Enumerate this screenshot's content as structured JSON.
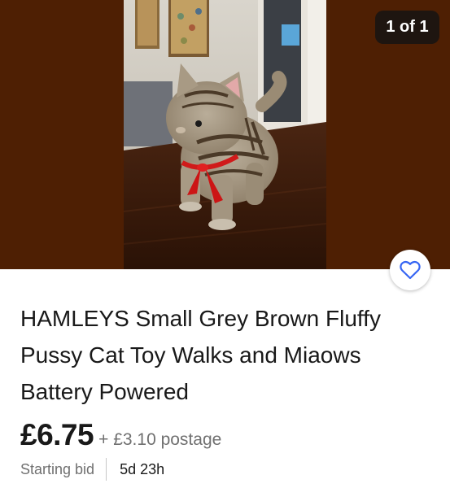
{
  "gallery": {
    "counter": "1 of 1",
    "background_color": "#4e1f03",
    "photo_subject": "grey-brown striped toy cat with red ribbon on wooden table"
  },
  "watch_button": {
    "icon": "heart-outline-icon",
    "color": "#3665f3"
  },
  "listing": {
    "title": "HAMLEYS Small Grey Brown Fluffy Pussy Cat Toy Walks and Miaows Battery Powered",
    "price": "£6.75",
    "postage": "+ £3.10 postage",
    "bid_type": "Starting bid",
    "time_left": "5d 23h"
  }
}
